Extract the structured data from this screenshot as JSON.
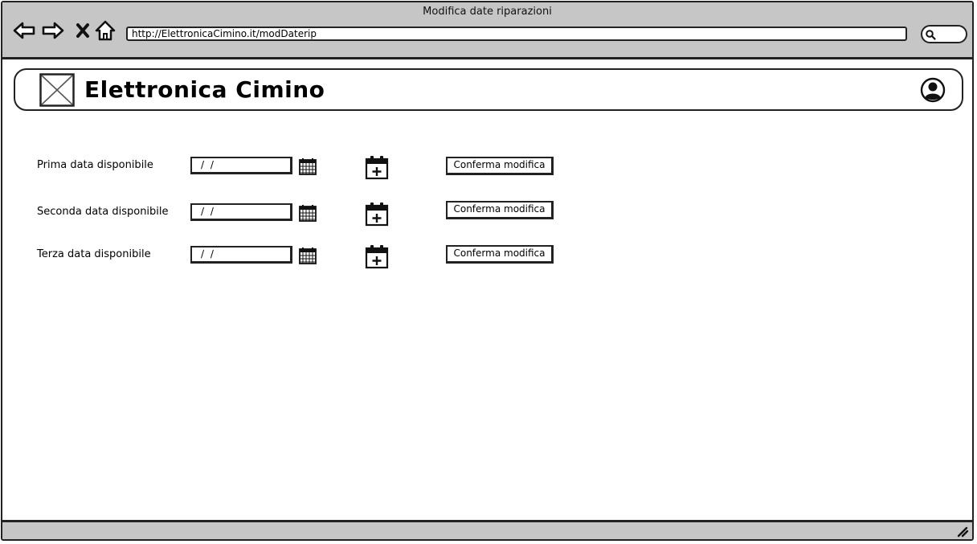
{
  "window": {
    "title": "Modifica date riparazioni"
  },
  "browser": {
    "url": "http://ElettronicaCimino.it/modDaterip",
    "icons": {
      "back": "arrow-left-icon",
      "forward": "arrow-right-icon",
      "stop": "close-icon",
      "home": "home-icon",
      "search": "search-icon"
    }
  },
  "header": {
    "brand": "Elettronica Cimino",
    "logo_icon": "image-placeholder-icon",
    "user_icon": "user-icon"
  },
  "rows": [
    {
      "label": "Prima data disponibile",
      "date_value": "/ /",
      "button": "Conferma modifica"
    },
    {
      "label": "Seconda data disponibile",
      "date_value": "/ /",
      "button": "Conferma modifica"
    },
    {
      "label": "Terza data disponibile",
      "date_value": "/ /",
      "button": "Conferma modifica"
    }
  ],
  "colors": {
    "chrome": "#c6c6c6",
    "stroke": "#222222",
    "background": "#ffffff"
  }
}
